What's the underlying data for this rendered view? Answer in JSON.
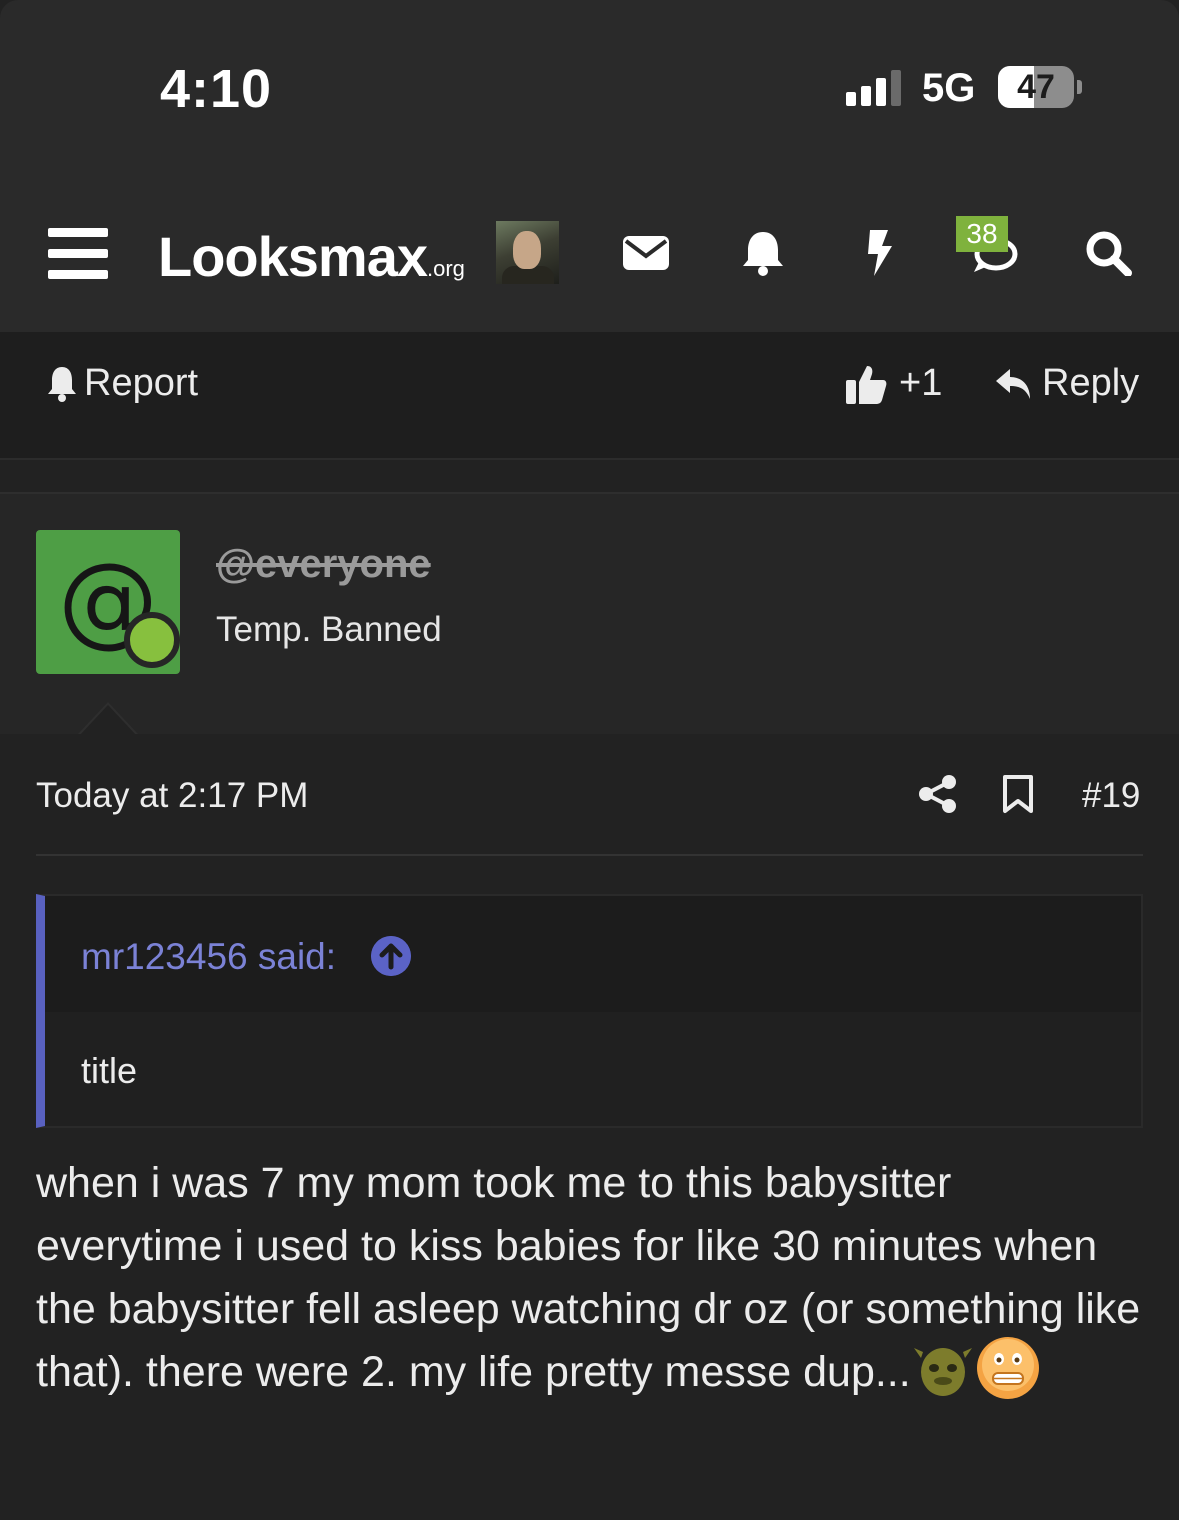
{
  "status_bar": {
    "time": "4:10",
    "network": "5G",
    "battery": "47",
    "battery_level": 0.47
  },
  "navbar": {
    "logo_main": "Looksmax",
    "logo_suffix": ".org",
    "conversations_badge": "38",
    "icons": [
      "menu-icon",
      "avatar",
      "envelope-icon",
      "bell-icon",
      "bolt-icon",
      "conversations-icon",
      "search-icon"
    ]
  },
  "actions": {
    "report_label": "Report",
    "like_label": "+1",
    "reply_label": "Reply"
  },
  "post": {
    "author": {
      "name": "@everyone",
      "avatar_glyph": "@",
      "title": "Temp. Banned",
      "online": true
    },
    "timestamp": "Today at 2:17 PM",
    "number": "#19",
    "quote": {
      "author_line": "mr123456 said:",
      "text": "title"
    },
    "body": "when i was 7 my mom took me to this babysitter everytime i used to kiss babies for like 30 minutes when the babysitter fell asleep watching dr oz (or something like that). there were 2. my life pretty messe dup...",
    "emojis": [
      "shrek-emoji",
      "grimace-emoji"
    ]
  },
  "colors": {
    "background": "#222222",
    "header": "#2a2a2a",
    "badge": "#7fb23d",
    "avatar_green": "#4e9e45",
    "online": "#87c03e",
    "quote_accent": "#5961c0"
  }
}
